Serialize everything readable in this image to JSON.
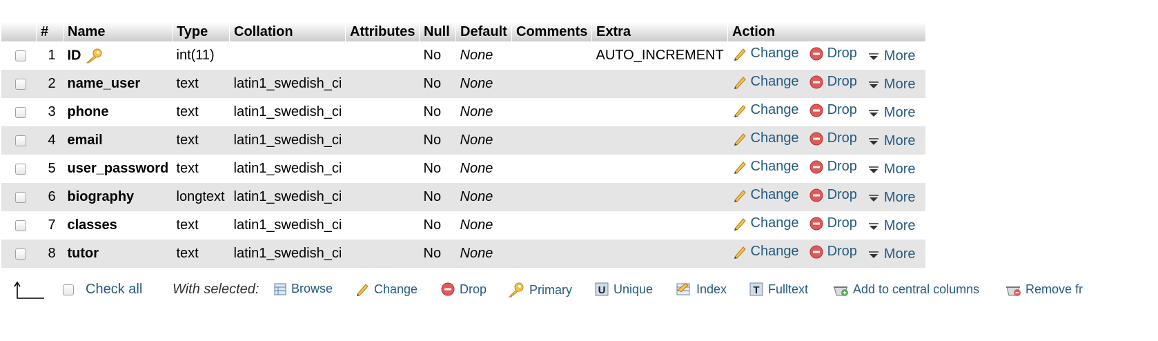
{
  "headers": [
    "#",
    "Name",
    "Type",
    "Collation",
    "Attributes",
    "Null",
    "Default",
    "Comments",
    "Extra",
    "Action"
  ],
  "rows": [
    {
      "num": "1",
      "name": "ID",
      "type": "int(11)",
      "collation": "",
      "attributes": "",
      "null": "No",
      "default": "None",
      "comments": "",
      "extra": "AUTO_INCREMENT"
    },
    {
      "num": "2",
      "name": "name_user",
      "type": "text",
      "collation": "latin1_swedish_ci",
      "attributes": "",
      "null": "No",
      "default": "None",
      "comments": "",
      "extra": ""
    },
    {
      "num": "3",
      "name": "phone",
      "type": "text",
      "collation": "latin1_swedish_ci",
      "attributes": "",
      "null": "No",
      "default": "None",
      "comments": "",
      "extra": ""
    },
    {
      "num": "4",
      "name": "email",
      "type": "text",
      "collation": "latin1_swedish_ci",
      "attributes": "",
      "null": "No",
      "default": "None",
      "comments": "",
      "extra": ""
    },
    {
      "num": "5",
      "name": "user_password",
      "type": "text",
      "collation": "latin1_swedish_ci",
      "attributes": "",
      "null": "No",
      "default": "None",
      "comments": "",
      "extra": ""
    },
    {
      "num": "6",
      "name": "biography",
      "type": "longtext",
      "collation": "latin1_swedish_ci",
      "attributes": "",
      "null": "No",
      "default": "None",
      "comments": "",
      "extra": ""
    },
    {
      "num": "7",
      "name": "classes",
      "type": "text",
      "collation": "latin1_swedish_ci",
      "attributes": "",
      "null": "No",
      "default": "None",
      "comments": "",
      "extra": ""
    },
    {
      "num": "8",
      "name": "tutor",
      "type": "text",
      "collation": "latin1_swedish_ci",
      "attributes": "",
      "null": "No",
      "default": "None",
      "comments": "",
      "extra": ""
    }
  ],
  "row_actions": {
    "change": "Change",
    "drop": "Drop",
    "more": "More"
  },
  "footer": {
    "check_all": "Check all",
    "with_selected": "With selected:",
    "browse": "Browse",
    "change": "Change",
    "drop": "Drop",
    "primary": "Primary",
    "unique": "Unique",
    "index": "Index",
    "fulltext": "Fulltext",
    "add_central": "Add to central columns",
    "remove_central": "Remove fr"
  },
  "colors": {
    "link": "#235a81",
    "row_alt": "#e5e5e5",
    "drop_icon": "#d9534f",
    "key_icon": "#e6a817"
  }
}
